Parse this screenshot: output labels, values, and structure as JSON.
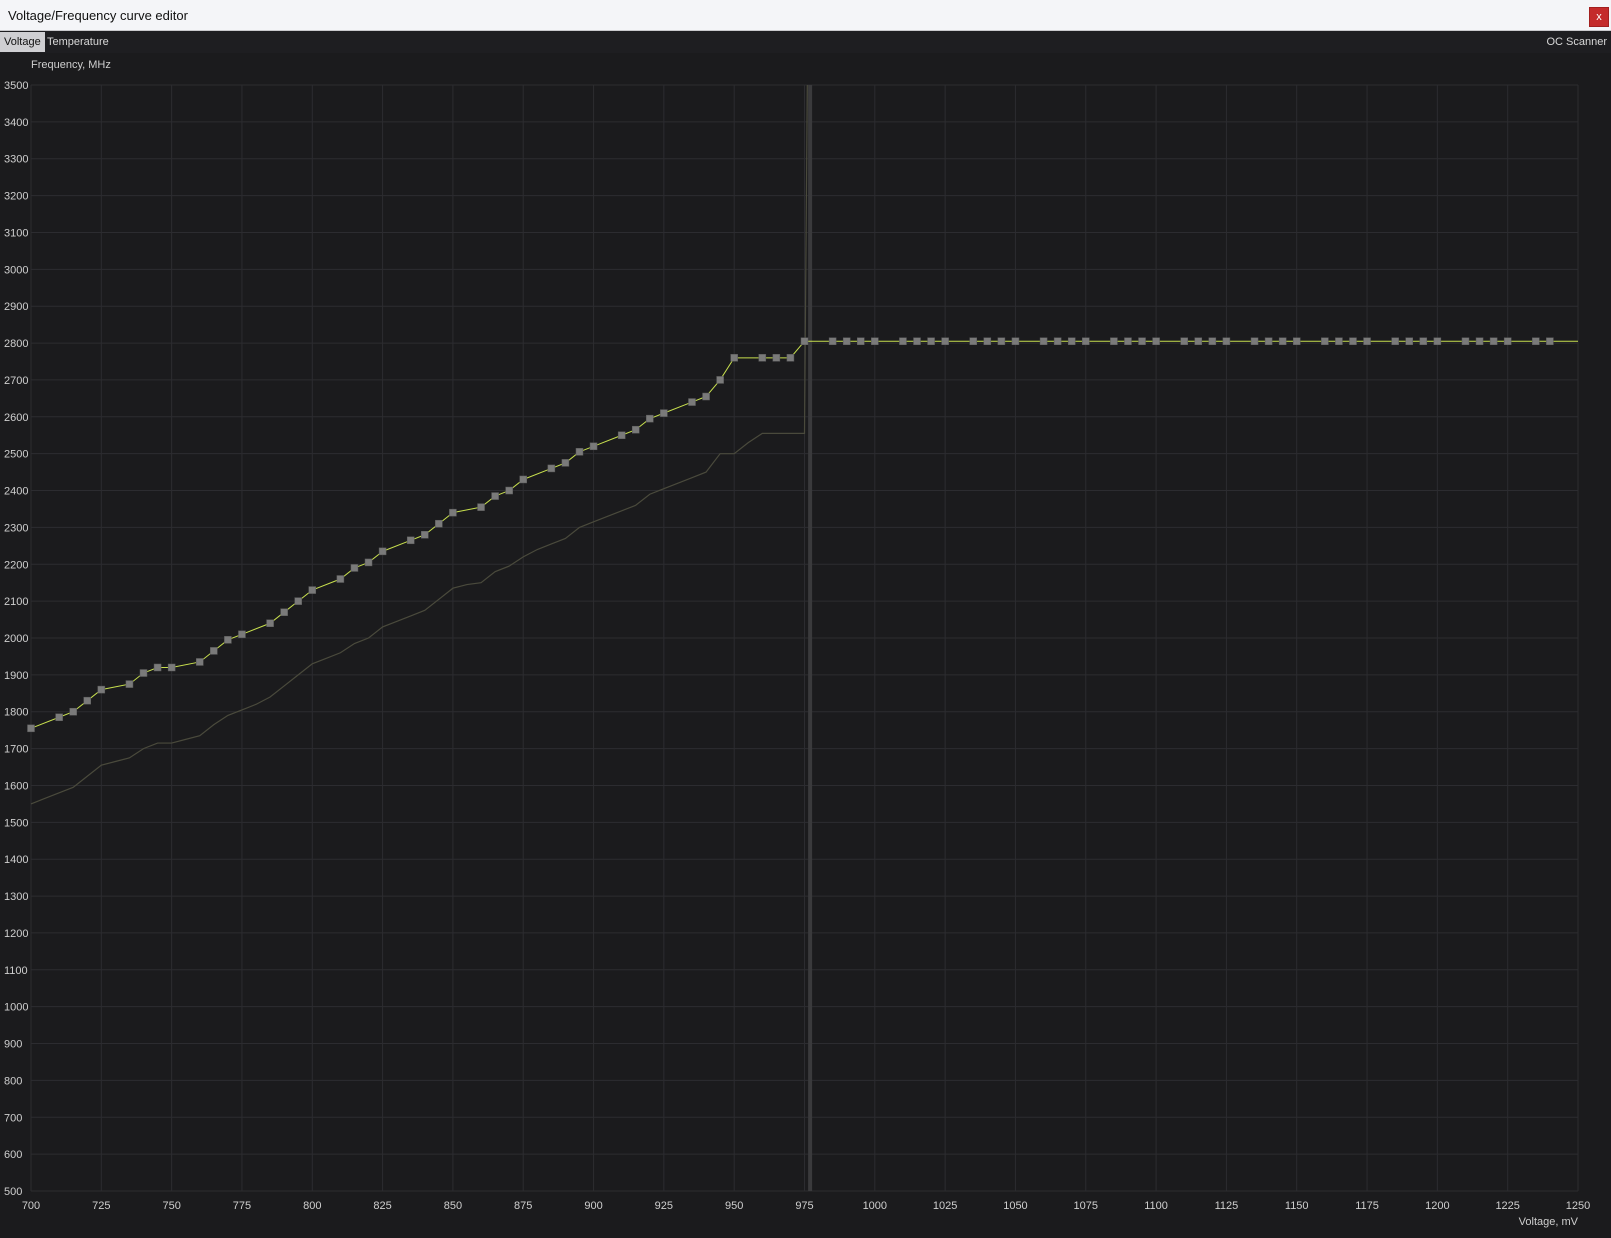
{
  "window": {
    "title": "Voltage/Frequency curve editor",
    "close_label": "x"
  },
  "toolbar": {
    "tabs": [
      {
        "label": "Voltage",
        "active": true
      },
      {
        "label": "Temperature",
        "active": false
      }
    ],
    "oc_scanner_label": "OC Scanner"
  },
  "colors": {
    "background": "#1b1b1d",
    "grid": "#2c2c30",
    "axis_text": "#cfcfcf",
    "active_curve": "#c8e04e",
    "base_curve": "#4a4a3c",
    "point_fill": "#7a7a7a",
    "current_marker": "#3a3a3c"
  },
  "chart_data": {
    "type": "line",
    "ylabel": "Frequency, MHz",
    "xlabel": "Voltage, mV",
    "xlim": [
      700,
      1250
    ],
    "ylim": [
      500,
      3500
    ],
    "x_ticks": [
      700,
      725,
      750,
      775,
      800,
      825,
      850,
      875,
      900,
      925,
      950,
      975,
      1000,
      1025,
      1050,
      1075,
      1100,
      1125,
      1150,
      1175,
      1200,
      1225,
      1250
    ],
    "y_ticks": [
      500,
      600,
      700,
      800,
      900,
      1000,
      1100,
      1200,
      1300,
      1400,
      1500,
      1600,
      1700,
      1800,
      1900,
      2000,
      2100,
      2200,
      2300,
      2400,
      2500,
      2600,
      2700,
      2800,
      2900,
      3000,
      3100,
      3200,
      3300,
      3400,
      3500
    ],
    "grid": true,
    "current_voltage_marker": 977,
    "series": [
      {
        "role": "edited curve",
        "points": [
          [
            700,
            1755
          ],
          [
            710,
            1785
          ],
          [
            715,
            1800
          ],
          [
            720,
            1830
          ],
          [
            725,
            1860
          ],
          [
            735,
            1875
          ],
          [
            740,
            1905
          ],
          [
            745,
            1920
          ],
          [
            750,
            1920
          ],
          [
            760,
            1935
          ],
          [
            765,
            1965
          ],
          [
            770,
            1995
          ],
          [
            775,
            2010
          ],
          [
            785,
            2040
          ],
          [
            790,
            2070
          ],
          [
            795,
            2100
          ],
          [
            800,
            2130
          ],
          [
            810,
            2160
          ],
          [
            815,
            2190
          ],
          [
            820,
            2205
          ],
          [
            825,
            2235
          ],
          [
            835,
            2265
          ],
          [
            840,
            2280
          ],
          [
            845,
            2310
          ],
          [
            850,
            2340
          ],
          [
            860,
            2355
          ],
          [
            865,
            2385
          ],
          [
            870,
            2400
          ],
          [
            875,
            2430
          ],
          [
            885,
            2460
          ],
          [
            890,
            2475
          ],
          [
            895,
            2505
          ],
          [
            900,
            2520
          ],
          [
            910,
            2550
          ],
          [
            915,
            2565
          ],
          [
            920,
            2595
          ],
          [
            925,
            2610
          ],
          [
            935,
            2640
          ],
          [
            940,
            2655
          ],
          [
            945,
            2700
          ],
          [
            950,
            2760
          ],
          [
            960,
            2760
          ],
          [
            965,
            2760
          ],
          [
            970,
            2760
          ],
          [
            975,
            2805
          ],
          [
            985,
            2805
          ],
          [
            990,
            2805
          ],
          [
            995,
            2805
          ],
          [
            1000,
            2805
          ],
          [
            1010,
            2805
          ],
          [
            1015,
            2805
          ],
          [
            1020,
            2805
          ],
          [
            1025,
            2805
          ],
          [
            1035,
            2805
          ],
          [
            1040,
            2805
          ],
          [
            1045,
            2805
          ],
          [
            1050,
            2805
          ],
          [
            1060,
            2805
          ],
          [
            1065,
            2805
          ],
          [
            1070,
            2805
          ],
          [
            1075,
            2805
          ],
          [
            1085,
            2805
          ],
          [
            1090,
            2805
          ],
          [
            1095,
            2805
          ],
          [
            1100,
            2805
          ],
          [
            1110,
            2805
          ],
          [
            1115,
            2805
          ],
          [
            1120,
            2805
          ],
          [
            1125,
            2805
          ],
          [
            1135,
            2805
          ],
          [
            1140,
            2805
          ],
          [
            1145,
            2805
          ],
          [
            1150,
            2805
          ],
          [
            1160,
            2805
          ],
          [
            1165,
            2805
          ],
          [
            1170,
            2805
          ],
          [
            1175,
            2805
          ],
          [
            1185,
            2805
          ],
          [
            1190,
            2805
          ],
          [
            1195,
            2805
          ],
          [
            1200,
            2805
          ],
          [
            1210,
            2805
          ],
          [
            1215,
            2805
          ],
          [
            1220,
            2805
          ],
          [
            1225,
            2805
          ],
          [
            1235,
            2805
          ],
          [
            1240,
            2805
          ]
        ],
        "tail_to": [
          1250,
          2805
        ]
      },
      {
        "role": "default curve",
        "points": [
          [
            700,
            1550
          ],
          [
            705,
            1565
          ],
          [
            710,
            1580
          ],
          [
            715,
            1595
          ],
          [
            720,
            1625
          ],
          [
            725,
            1655
          ],
          [
            730,
            1665
          ],
          [
            735,
            1675
          ],
          [
            740,
            1700
          ],
          [
            745,
            1715
          ],
          [
            750,
            1715
          ],
          [
            755,
            1725
          ],
          [
            760,
            1735
          ],
          [
            765,
            1765
          ],
          [
            770,
            1790
          ],
          [
            775,
            1805
          ],
          [
            780,
            1820
          ],
          [
            785,
            1840
          ],
          [
            790,
            1870
          ],
          [
            795,
            1900
          ],
          [
            800,
            1930
          ],
          [
            805,
            1945
          ],
          [
            810,
            1960
          ],
          [
            815,
            1985
          ],
          [
            820,
            2000
          ],
          [
            825,
            2030
          ],
          [
            830,
            2045
          ],
          [
            835,
            2060
          ],
          [
            840,
            2075
          ],
          [
            845,
            2105
          ],
          [
            850,
            2135
          ],
          [
            855,
            2145
          ],
          [
            860,
            2150
          ],
          [
            865,
            2180
          ],
          [
            870,
            2195
          ],
          [
            875,
            2220
          ],
          [
            880,
            2240
          ],
          [
            885,
            2255
          ],
          [
            890,
            2270
          ],
          [
            895,
            2300
          ],
          [
            900,
            2315
          ],
          [
            905,
            2330
          ],
          [
            910,
            2345
          ],
          [
            915,
            2360
          ],
          [
            920,
            2390
          ],
          [
            925,
            2405
          ],
          [
            930,
            2420
          ],
          [
            935,
            2435
          ],
          [
            940,
            2450
          ],
          [
            945,
            2500
          ],
          [
            950,
            2500
          ],
          [
            955,
            2530
          ],
          [
            960,
            2555
          ],
          [
            965,
            2555
          ],
          [
            970,
            2555
          ],
          [
            975,
            2555
          ]
        ],
        "tail_to": [
          976,
          3500
        ]
      }
    ]
  }
}
